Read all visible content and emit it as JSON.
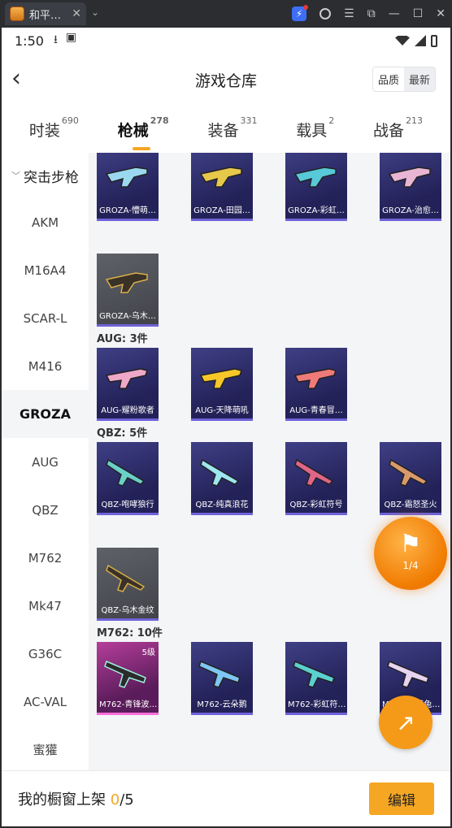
{
  "browser": {
    "tab_title": "和平…",
    "tab_close": "✕",
    "tab_menu": "⌄",
    "icons": [
      "bolt-icon",
      "user-icon",
      "menu-icon",
      "screenshot-icon",
      "minimize-icon",
      "maximize-icon",
      "close-icon"
    ]
  },
  "status": {
    "time": "1:50"
  },
  "header": {
    "back": "‹",
    "title": "游戏仓库",
    "sort_quality": "品质",
    "sort_newest": "最新"
  },
  "category_tabs": [
    {
      "label": "时装",
      "count": "690"
    },
    {
      "label": "枪械",
      "count": "278",
      "active": true
    },
    {
      "label": "装备",
      "count": "331"
    },
    {
      "label": "载具",
      "count": "2"
    },
    {
      "label": "战备",
      "count": "213"
    }
  ],
  "sidebar": {
    "group": "突击步枪",
    "items": [
      "AKM",
      "M16A4",
      "SCAR-L",
      "M416",
      "GROZA",
      "AUG",
      "QBZ",
      "M762",
      "Mk47",
      "G36C",
      "AC-VAL",
      "蜜獾"
    ],
    "active": "GROZA"
  },
  "sections": {
    "groza_row1": [
      "GROZA-懵萌…",
      "GROZA-田园…",
      "GROZA-彩虹…",
      "GROZA-治愈…"
    ],
    "groza_row2": [
      "GROZA-乌木…"
    ],
    "aug_title": "AUG: 3件",
    "aug": [
      "AUG-耀粉歌者",
      "AUG-天降萌吼",
      "AUG-青春冒…"
    ],
    "qbz_title": "QBZ: 5件",
    "qbz_row1": [
      "QBZ-咆哮狼行",
      "QBZ-纯真浪花",
      "QBZ-彩虹符号",
      "QBZ-霜怒圣火"
    ],
    "qbz_row2": [
      "QBZ-乌木金纹"
    ],
    "m762_title": "M762: 10件",
    "m762": [
      "M762-青锋波…",
      "M762-云朵鹅",
      "M762-彩虹符…",
      "M762-雅菊兔…"
    ],
    "m762_level": "5级"
  },
  "float_button": {
    "page": "1/4"
  },
  "bottom": {
    "label": "我的橱窗上架",
    "count": "0",
    "total": "/5",
    "edit": "编辑"
  },
  "colors": {
    "accent": "#f5a623",
    "card_blue": "#2b2a66",
    "card_pink": "#9c2f82",
    "card_gray": "#54565c"
  }
}
